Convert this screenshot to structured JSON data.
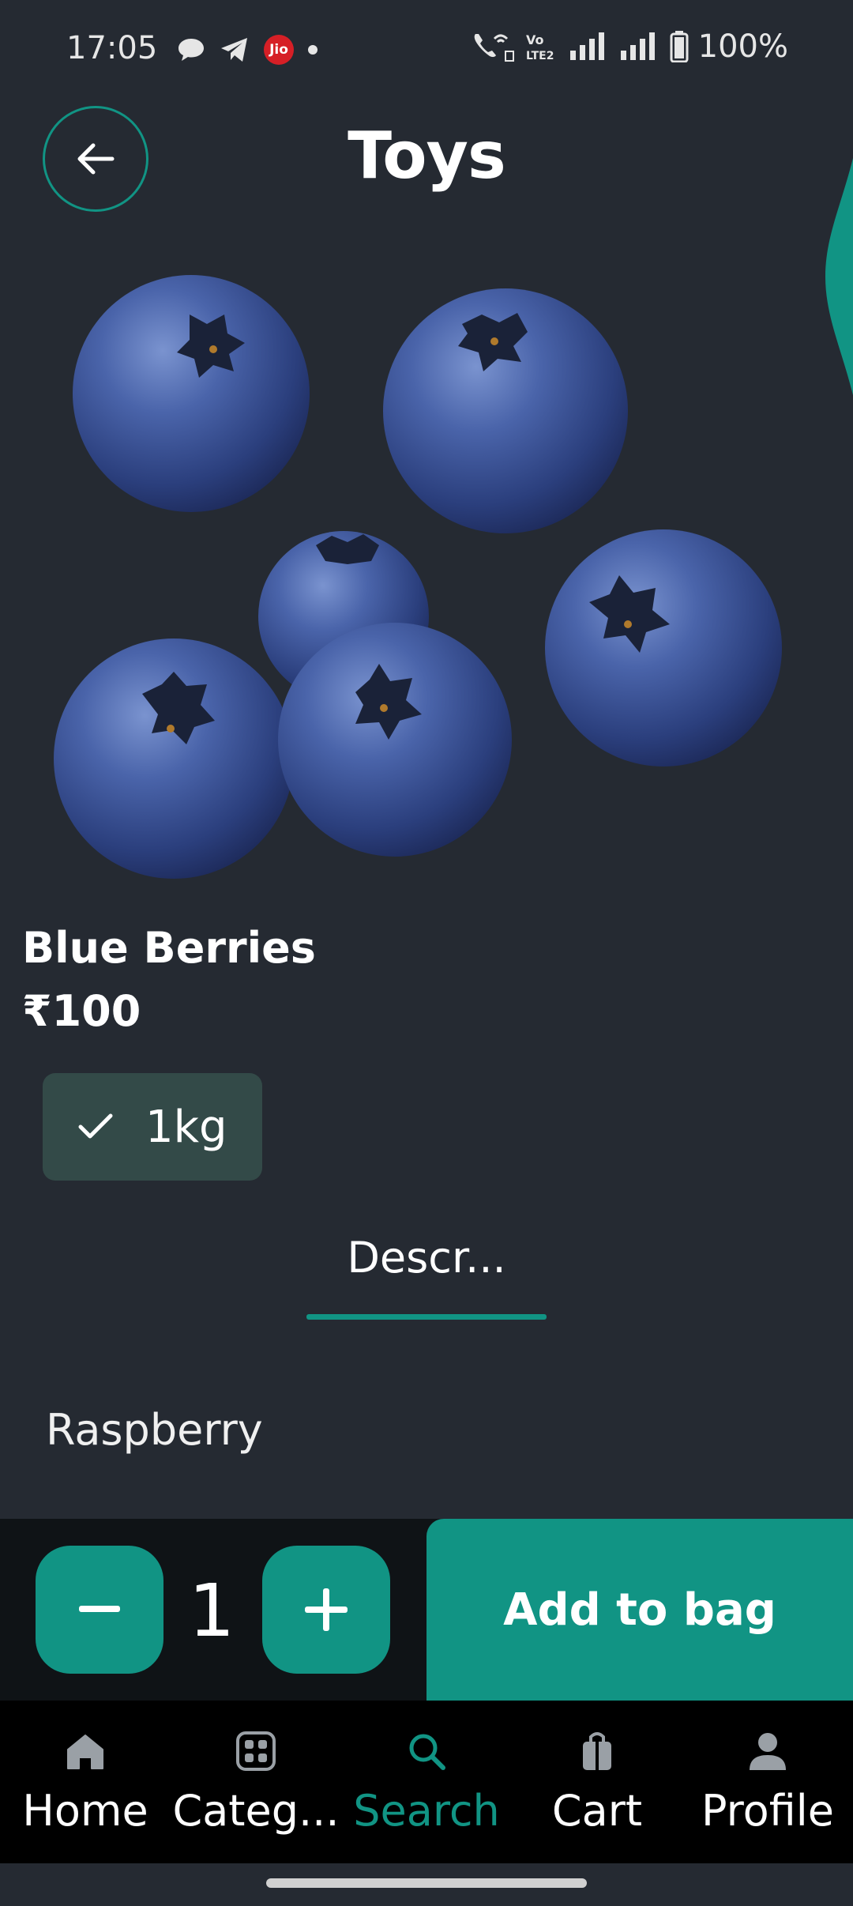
{
  "status_bar": {
    "time": "17:05",
    "carrier_badge": "Jio",
    "battery": "100%",
    "icons": [
      "chat-bubble-icon",
      "telegram-icon",
      "jio-icon",
      "notification-dot-icon",
      "wifi-call-icon",
      "volte-icon",
      "signal-icon",
      "signal-icon",
      "battery-icon"
    ]
  },
  "header": {
    "title": "Toys",
    "back_icon": "arrow-left-icon"
  },
  "product": {
    "name": "Blue Berries",
    "price": "₹100",
    "image_icon": "blueberries-image",
    "variant": {
      "label": "1kg",
      "selected": true,
      "icon": "check-icon"
    },
    "tab": "Descr...",
    "description": "Raspberry"
  },
  "actions": {
    "quantity": "1",
    "minus_icon": "minus-icon",
    "plus_icon": "plus-icon",
    "add_to_bag": "Add to bag"
  },
  "bottom_nav": {
    "items": [
      {
        "label": "Home",
        "icon": "home-icon",
        "active": false
      },
      {
        "label": "Categ...",
        "icon": "grid-icon",
        "active": false
      },
      {
        "label": "Search",
        "icon": "search-icon",
        "active": true
      },
      {
        "label": "Cart",
        "icon": "bag-icon",
        "active": false
      },
      {
        "label": "Profile",
        "icon": "person-icon",
        "active": false
      }
    ]
  },
  "colors": {
    "background": "#252a32",
    "accent": "#119484",
    "chip": "#334a48",
    "action_bar": "#0f1316",
    "nav_bar": "#000000"
  }
}
